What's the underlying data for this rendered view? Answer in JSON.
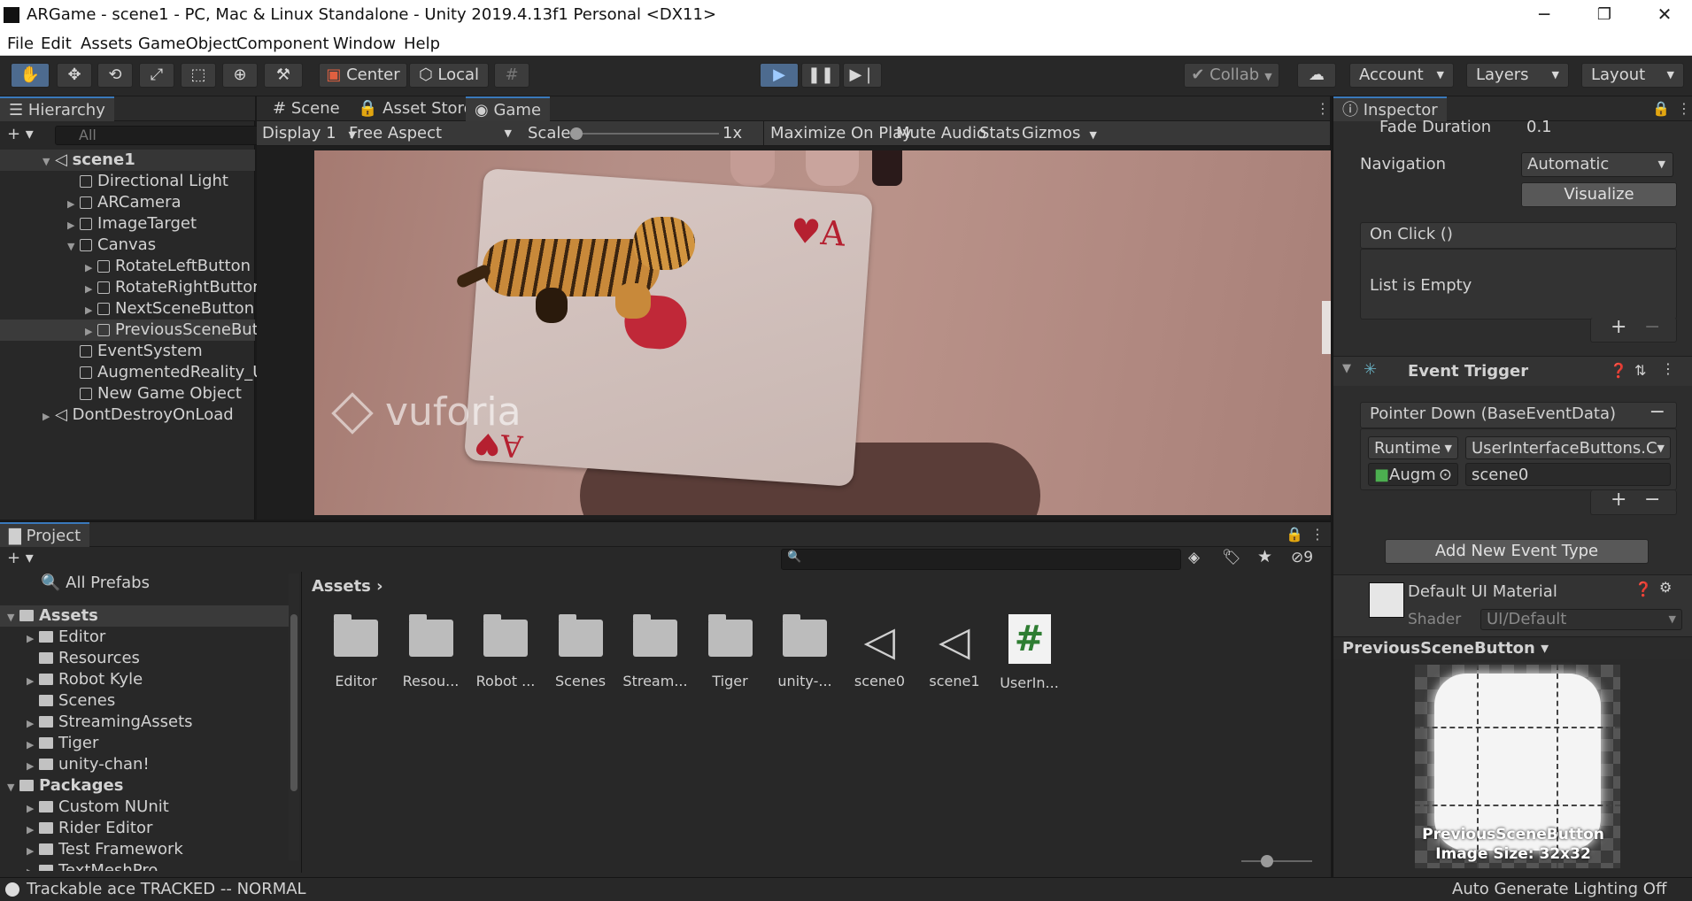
{
  "window": {
    "title": "ARGame - scene1 - PC, Mac & Linux Standalone - Unity 2019.4.13f1 Personal <DX11>",
    "minimize": "─",
    "restore": "❐",
    "close": "✕"
  },
  "menu": [
    "File",
    "Edit",
    "Assets",
    "GameObject",
    "Component",
    "Window",
    "Help"
  ],
  "toolbar": {
    "tools": [
      "hand-tool",
      "move-tool",
      "rotate-tool",
      "scale-tool",
      "rect-tool",
      "transform-tool",
      "custom-tool"
    ],
    "pivot_mode": "Center",
    "pivot_space": "Local",
    "collab": "Collab",
    "account": "Account",
    "layers": "Layers",
    "layout": "Layout",
    "play_state": "playing"
  },
  "hierarchy": {
    "title": "Hierarchy",
    "search_placeholder": "All",
    "items": [
      {
        "label": "scene1",
        "indent": 0,
        "type": "scene",
        "expanded": true
      },
      {
        "label": "Directional Light",
        "indent": 1,
        "type": "object"
      },
      {
        "label": "ARCamera",
        "indent": 1,
        "type": "object",
        "collapsed": true
      },
      {
        "label": "ImageTarget",
        "indent": 1,
        "type": "object",
        "collapsed": true
      },
      {
        "label": "Canvas",
        "indent": 1,
        "type": "object",
        "expanded": true
      },
      {
        "label": "RotateLeftButton",
        "indent": 2,
        "type": "object",
        "collapsed": true
      },
      {
        "label": "RotateRightButton",
        "indent": 2,
        "type": "object",
        "collapsed": true
      },
      {
        "label": "NextSceneButton",
        "indent": 2,
        "type": "object",
        "collapsed": true
      },
      {
        "label": "PreviousSceneButton",
        "indent": 2,
        "type": "object",
        "collapsed": true,
        "selected": true
      },
      {
        "label": "EventSystem",
        "indent": 1,
        "type": "object"
      },
      {
        "label": "AugmentedReality_UI",
        "indent": 1,
        "type": "object"
      },
      {
        "label": "New Game Object",
        "indent": 1,
        "type": "object"
      },
      {
        "label": "DontDestroyOnLoad",
        "indent": 0,
        "type": "scene",
        "collapsed": true
      }
    ]
  },
  "center_tabs": [
    "Scene",
    "Asset Store",
    "Game"
  ],
  "game_bar": {
    "display": "Display 1",
    "aspect": "Free Aspect",
    "scale_label": "Scale",
    "scale_value": "1x",
    "maximize": "Maximize On Play",
    "mute": "Mute Audio",
    "stats": "Stats",
    "gizmos": "Gizmos"
  },
  "game_view": {
    "watermark": "vuforia",
    "card_rank": "A",
    "card_suit": "♥"
  },
  "inspector": {
    "title": "Inspector",
    "fade_duration_label": "Fade Duration",
    "fade_duration_value": "0.1",
    "navigation_label": "Navigation",
    "navigation_value": "Automatic",
    "visualize": "Visualize",
    "onclick_header": "On Click ()",
    "list_empty": "List is Empty",
    "event_trigger_title": "Event Trigger",
    "pointer_down": "Pointer Down (BaseEventData)",
    "runtime": "Runtime",
    "function": "UserInterfaceButtons.C",
    "object_ref": "Augm",
    "argument": "scene0",
    "add_event": "Add New Event Type",
    "material_name": "Default UI Material",
    "shader_label": "Shader",
    "shader_value": "UI/Default",
    "preview_title": "PreviousSceneButton",
    "preview_name": "PreviousSceneButton",
    "preview_size": "Image Size: 32x32"
  },
  "project": {
    "title": "Project",
    "hidden_count": "9",
    "favorites": "All Prefabs",
    "breadcrumb": "Assets",
    "tree": [
      {
        "label": "Assets",
        "indent": 0,
        "bold": true,
        "expanded": true
      },
      {
        "label": "Editor",
        "indent": 1,
        "collapsed": true
      },
      {
        "label": "Resources",
        "indent": 1
      },
      {
        "label": "Robot Kyle",
        "indent": 1,
        "collapsed": true
      },
      {
        "label": "Scenes",
        "indent": 1
      },
      {
        "label": "StreamingAssets",
        "indent": 1,
        "collapsed": true
      },
      {
        "label": "Tiger",
        "indent": 1,
        "collapsed": true
      },
      {
        "label": "unity-chan!",
        "indent": 1,
        "collapsed": true
      },
      {
        "label": "Packages",
        "indent": 0,
        "bold": true,
        "expanded": true
      },
      {
        "label": "Custom NUnit",
        "indent": 1,
        "collapsed": true
      },
      {
        "label": "Rider Editor",
        "indent": 1,
        "collapsed": true
      },
      {
        "label": "Test Framework",
        "indent": 1,
        "collapsed": true
      },
      {
        "label": "TextMeshPro",
        "indent": 1,
        "collapsed": true
      }
    ],
    "assets": [
      {
        "label": "Editor",
        "kind": "folder"
      },
      {
        "label": "Resou...",
        "kind": "folder"
      },
      {
        "label": "Robot ...",
        "kind": "folder"
      },
      {
        "label": "Scenes",
        "kind": "folder"
      },
      {
        "label": "Stream...",
        "kind": "folder"
      },
      {
        "label": "Tiger",
        "kind": "folder"
      },
      {
        "label": "unity-...",
        "kind": "folder"
      },
      {
        "label": "scene0",
        "kind": "scene"
      },
      {
        "label": "scene1",
        "kind": "scene"
      },
      {
        "label": "UserIn...",
        "kind": "script"
      }
    ]
  },
  "status": {
    "message": "Trackable ace TRACKED -- NORMAL",
    "lighting": "Auto Generate Lighting Off"
  },
  "colors": {
    "accent": "#3a79bb",
    "play_active": "#4d6b8f",
    "script_icon": "#2e7d32"
  }
}
